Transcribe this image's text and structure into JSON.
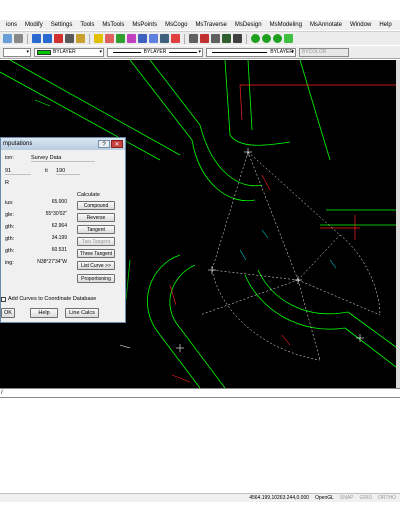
{
  "menu": [
    "ions",
    "Modify",
    "Settings",
    "Tools",
    "MsTools",
    "MsPoints",
    "MsCogo",
    "MsTraverse",
    "MsDesign",
    "MsModeling",
    "MsAnnotate",
    "Window",
    "Help"
  ],
  "toolbar2": {
    "layer_color": "BYLAYER",
    "linetype": "BYLAYER",
    "lineweight": "BYLAYER",
    "plotstyle": "BYCOLOR"
  },
  "dialog": {
    "title": "mputations",
    "description_label": "ion:",
    "description_value": "Survey Data",
    "point_from": "91",
    "to_label": "ti",
    "point_to": "190",
    "row_r": "R",
    "calculate_label": "Calculate",
    "fields": [
      {
        "label": "ius:",
        "value": "65.000"
      },
      {
        "label": "gle:",
        "value": "55°30'02\""
      },
      {
        "label": "gth:",
        "value": "62.964"
      },
      {
        "label": "gth:",
        "value": "34.199"
      },
      {
        "label": "gth:",
        "value": "60.531"
      },
      {
        "label": "ing:",
        "value": "N38°27'34\"W"
      }
    ],
    "buttons": [
      "Compound",
      "Reverse",
      "Tangent",
      "Two Tangent",
      "Three Tangent",
      "List Curve >>",
      "Proportioning"
    ],
    "checkbox_label": "Add Curves to Coordinate Database",
    "ok_label": "OK",
    "help_label": "Help",
    "linecalcs_label": "Line Calcs"
  },
  "statusbar": {
    "coords": "4564.199,10263.244,0.000",
    "opengl": "OpenGL",
    "snap": "SNAP",
    "grid": "GRID",
    "ortho": "ORTHO"
  },
  "colors": {
    "cad_background": "#000000",
    "green_lines": "#00ff00",
    "white_dashed": "#ffffff",
    "red_text": "#ff2020",
    "cyan_labels": "#00c8c8"
  }
}
